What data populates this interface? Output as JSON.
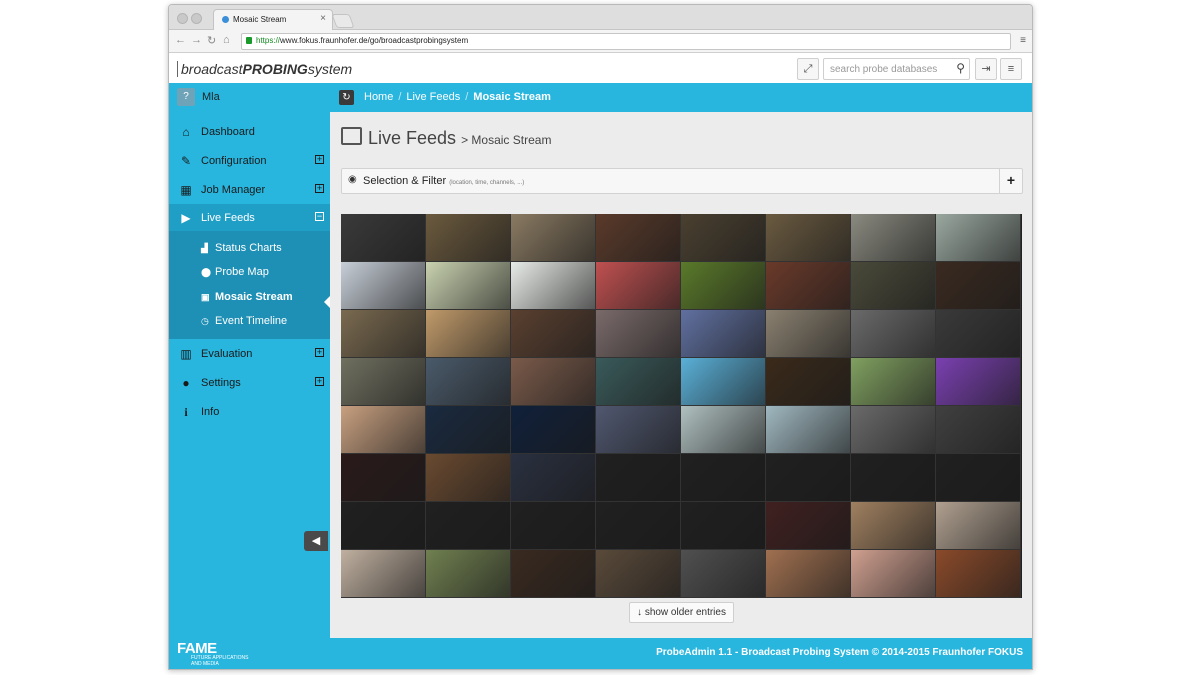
{
  "browser": {
    "tab_title": "Mosaic Stream",
    "url_scheme": "https://",
    "url_rest": "www.fokus.fraunhofer.de/go/broadcastprobingsystem"
  },
  "header": {
    "brand_prefix": "broadcast",
    "brand_bold": "PROBING",
    "brand_suffix": "system",
    "search_placeholder": "search probe databases"
  },
  "user": {
    "name": "Mla"
  },
  "breadcrumb": [
    "Home",
    "Live Feeds",
    "Mosaic Stream"
  ],
  "sidebar": {
    "items": [
      {
        "label": "Dashboard",
        "icon": "home-icon",
        "glyph": "⌂",
        "expandable": false
      },
      {
        "label": "Configuration",
        "icon": "edit-icon",
        "glyph": "✎",
        "expandable": true
      },
      {
        "label": "Job Manager",
        "icon": "calendar-icon",
        "glyph": "▦",
        "expandable": true
      },
      {
        "label": "Live Feeds",
        "icon": "play-icon",
        "glyph": "▶",
        "expandable": true,
        "active": true
      },
      {
        "label": "Evaluation",
        "icon": "bar-chart-icon",
        "glyph": "▥",
        "expandable": true
      },
      {
        "label": "Settings",
        "icon": "users-icon",
        "glyph": "●",
        "expandable": true
      },
      {
        "label": "Info",
        "icon": "info-icon",
        "glyph": "i",
        "expandable": false
      }
    ],
    "sub_items": [
      {
        "label": "Status Charts",
        "icon": "signal-icon",
        "glyph": "▟"
      },
      {
        "label": "Probe Map",
        "icon": "map-marker-icon",
        "glyph": "⬤"
      },
      {
        "label": "Mosaic Stream",
        "icon": "picture-icon",
        "glyph": "▣",
        "current": true
      },
      {
        "label": "Event Timeline",
        "icon": "clock-icon",
        "glyph": "◷"
      }
    ]
  },
  "content": {
    "title": "Live Feeds",
    "subtitle": "> Mosaic Stream",
    "filter_label": "Selection & Filter",
    "filter_hint": "(location, time, channels, ...)",
    "older_button": "show older entries"
  },
  "mosaic_tiles": [
    "#3a3a3a",
    "#6b5a3e",
    "#8a7a62",
    "#5a3a2a",
    "#4a4030",
    "#6a5a40",
    "#8a8a80",
    "#9aa8a0",
    "#c8cfd8",
    "#c9d2b0",
    "#e8ece8",
    "#c05050",
    "#5a7a2a",
    "#6a3a2a",
    "#4a4a3a",
    "#3a2a20",
    "#7a6a50",
    "#c09a6a",
    "#5a4030",
    "#7a6a6a",
    "#6070a0",
    "#8a8070",
    "#6a6a6a",
    "#3a3a3a",
    "#707060",
    "#4a5a6a",
    "#7a5a4a",
    "#3a5a5a",
    "#5ab0d8",
    "#3a2a1a",
    "#80a060",
    "#7a40b0",
    "#c8a080",
    "#1a2a40",
    "#10203a",
    "#505870",
    "#b0c0c0",
    "#a0b8c0",
    "#6a6a6a",
    "#404040",
    "#2a1a1a",
    "#6a4a30",
    "#2a3040",
    "#202020",
    "#202020",
    "#202020",
    "#202020",
    "#202020",
    "#202020",
    "#202020",
    "#202020",
    "#202020",
    "#202020",
    "#402020",
    "#a08060",
    "#b0a090",
    "#c0b0a0",
    "#708050",
    "#3a2a20",
    "#5a4a3a",
    "#505050",
    "#a07050",
    "#d0a090",
    "#8a4a2a"
  ],
  "footer": {
    "logo": "FAME",
    "tagline_1": "FUTURE APPLICATIONS",
    "tagline_2": "AND MEDIA",
    "copyright": "ProbeAdmin 1.1 - Broadcast Probing System © 2014-2015 Fraunhofer FOKUS"
  },
  "colors": {
    "accent": "#28b6df",
    "active": "#1f9ec6",
    "subnav": "#1e8fb5"
  }
}
